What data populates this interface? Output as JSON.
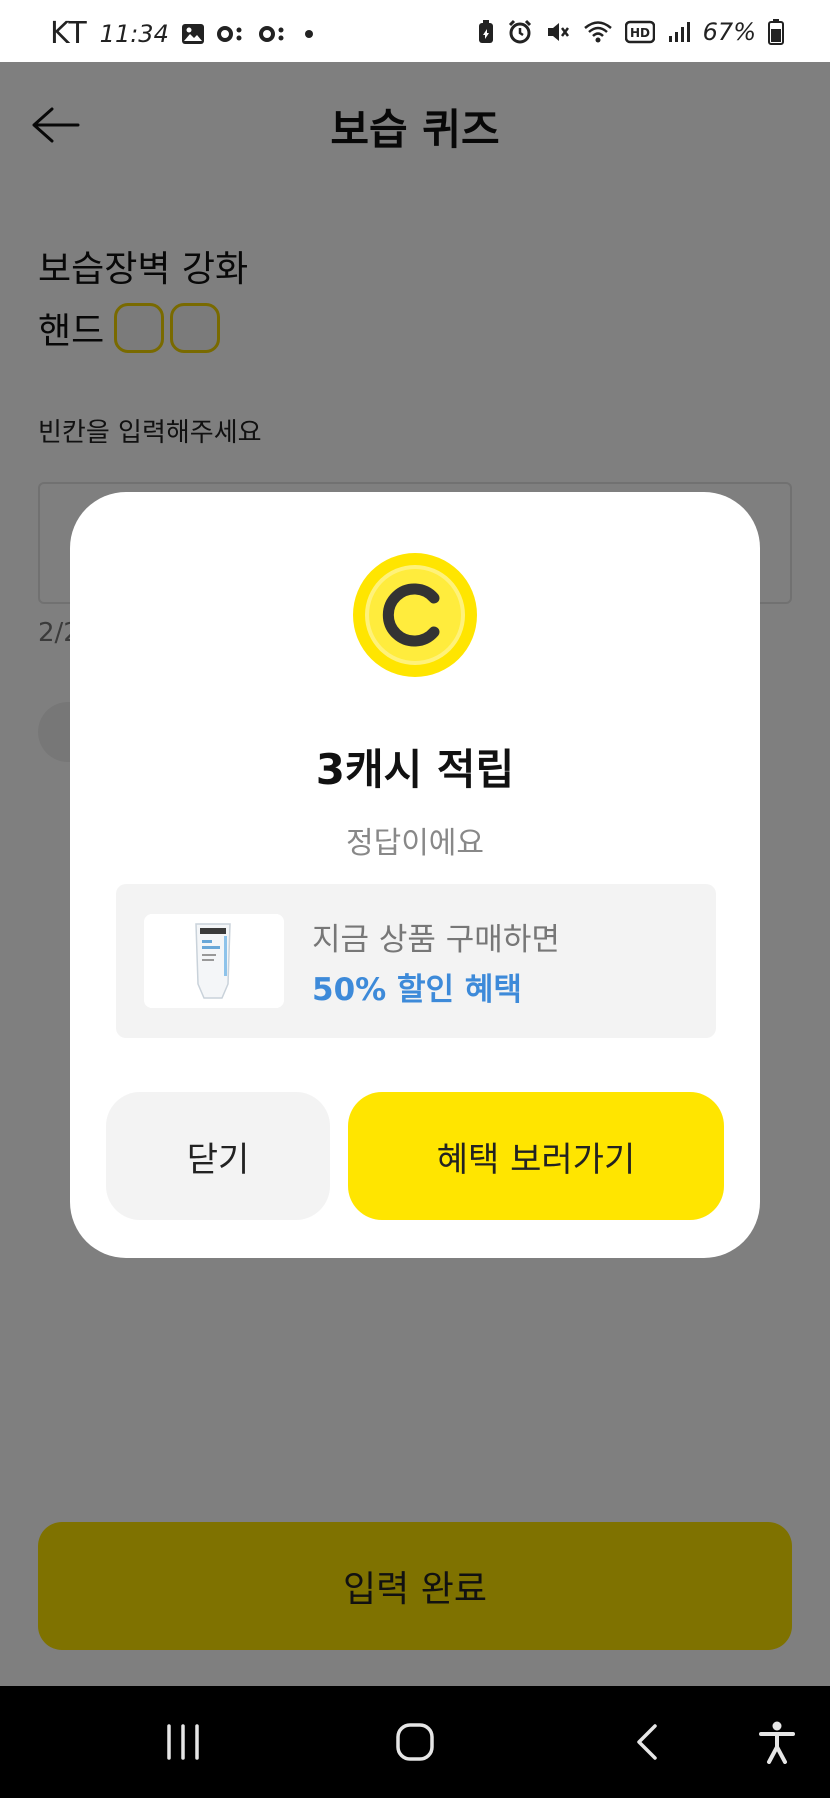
{
  "status_bar": {
    "carrier": "KT",
    "time": "11:34",
    "battery_percent": "67%",
    "icons": [
      "image-icon",
      "talk-icon",
      "talk-icon",
      "dot-icon",
      "battery-saver-icon",
      "alarm-icon",
      "mute-icon",
      "wifi-icon",
      "hd-icon",
      "signal-icon",
      "battery-icon"
    ]
  },
  "header": {
    "title": "보습 퀴즈",
    "back_icon": "arrow-left-icon"
  },
  "quiz": {
    "line1": "보습장벽 강화",
    "line2_word": "핸드",
    "blank_count": 2,
    "instruction": "빈칸을 입력해주세요",
    "char_count": "2/2"
  },
  "submit": {
    "label": "입력 완료"
  },
  "modal": {
    "coin_icon": "cash-coin-icon",
    "title": "3캐시 적립",
    "subtitle": "정답이에요",
    "promo": {
      "line1": "지금 상품 구매하면",
      "line2": "50% 할인 혜택"
    },
    "close_label": "닫기",
    "benefit_label": "혜택 보러가기"
  },
  "colors": {
    "accent_yellow": "#ffe500",
    "promo_blue": "#3d8ad9",
    "overlay": "rgba(0,0,0,0.5)"
  },
  "nav_bar": {
    "icons": [
      "recent-apps-icon",
      "home-icon",
      "back-icon",
      "accessibility-icon"
    ]
  }
}
